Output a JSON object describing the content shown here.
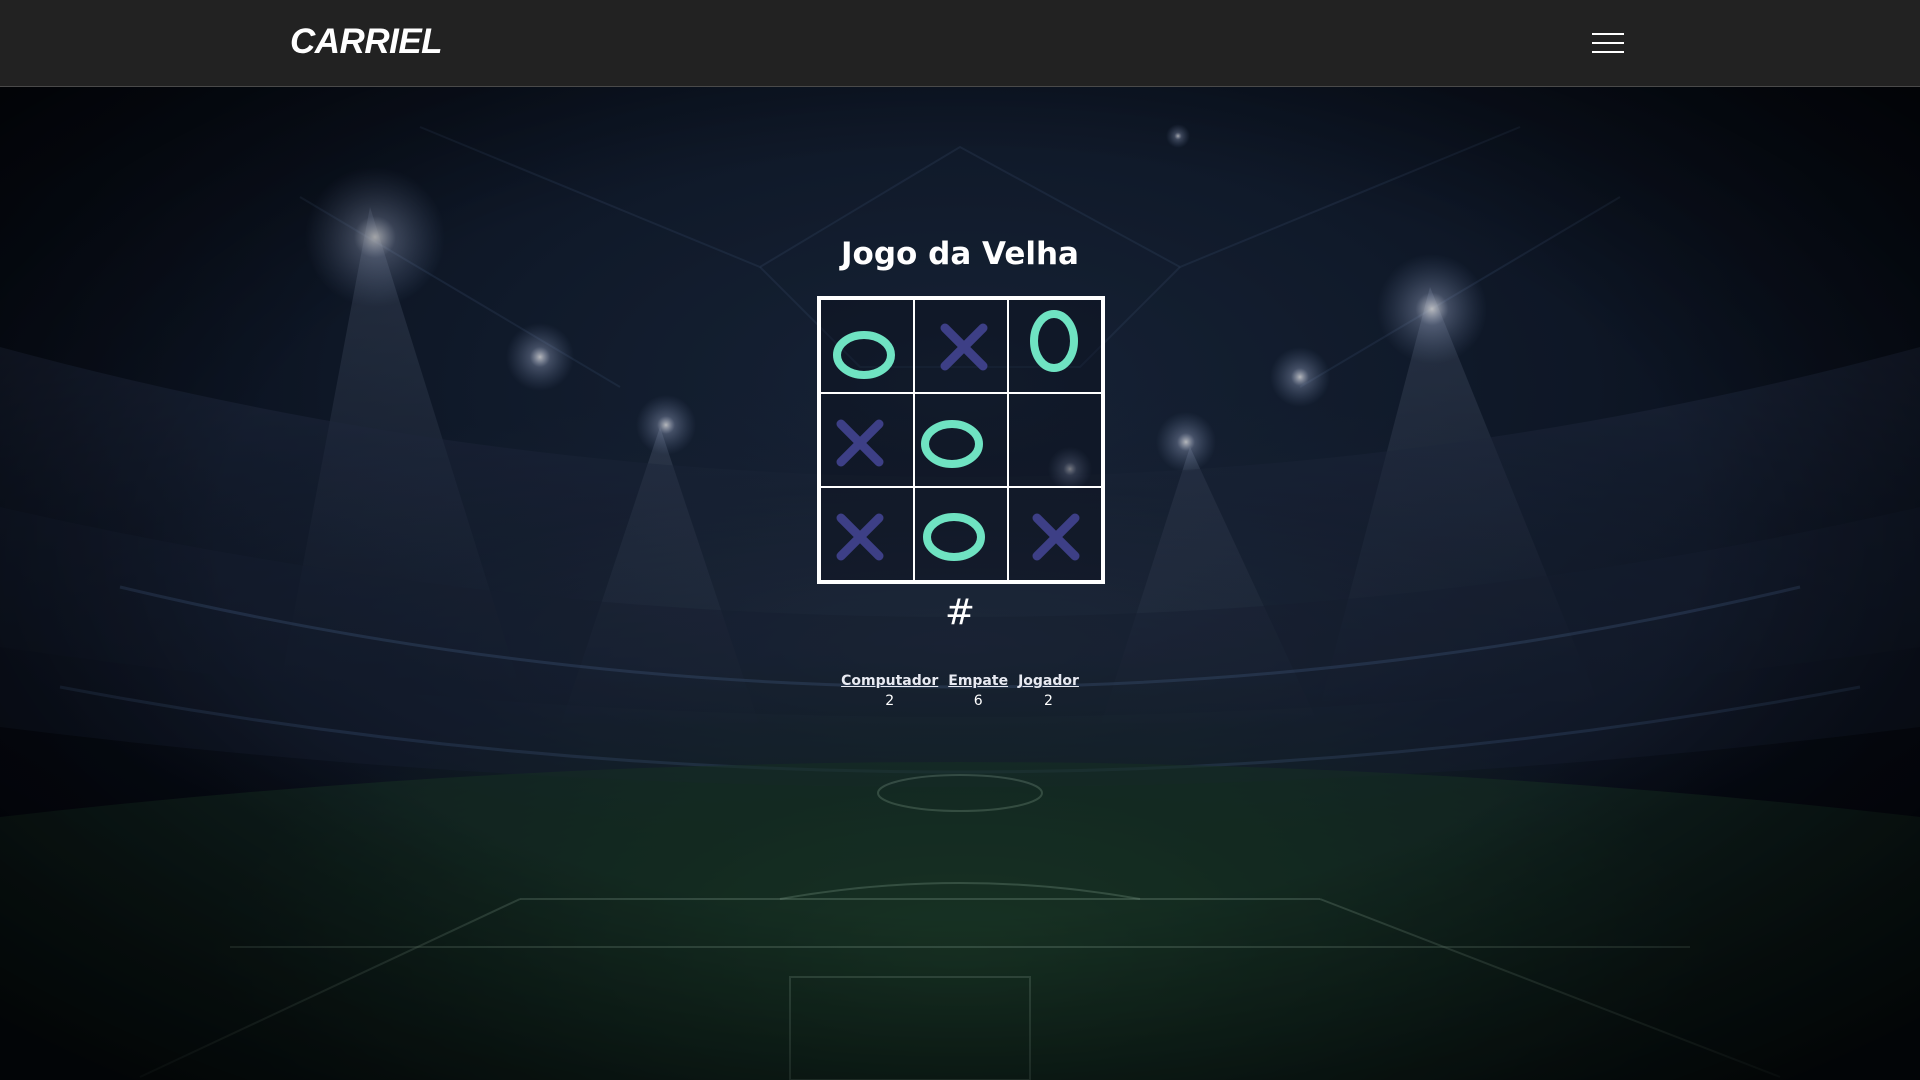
{
  "navbar": {
    "brand": "CARRIEL",
    "menu_icon": "hamburger-menu-icon"
  },
  "game": {
    "title": "Jogo da Velha",
    "status": "#",
    "board": [
      "O",
      "X",
      "0",
      "X",
      "O",
      "",
      "X",
      "O",
      "X"
    ],
    "colors": {
      "o_mark": "#6fe3c2",
      "x_mark": "#3d3f86",
      "grid": "#ffffff"
    }
  },
  "scores": [
    {
      "label": "Computador",
      "value": "2"
    },
    {
      "label": "Empate",
      "value": "6"
    },
    {
      "label": "Jogador",
      "value": "2"
    }
  ]
}
